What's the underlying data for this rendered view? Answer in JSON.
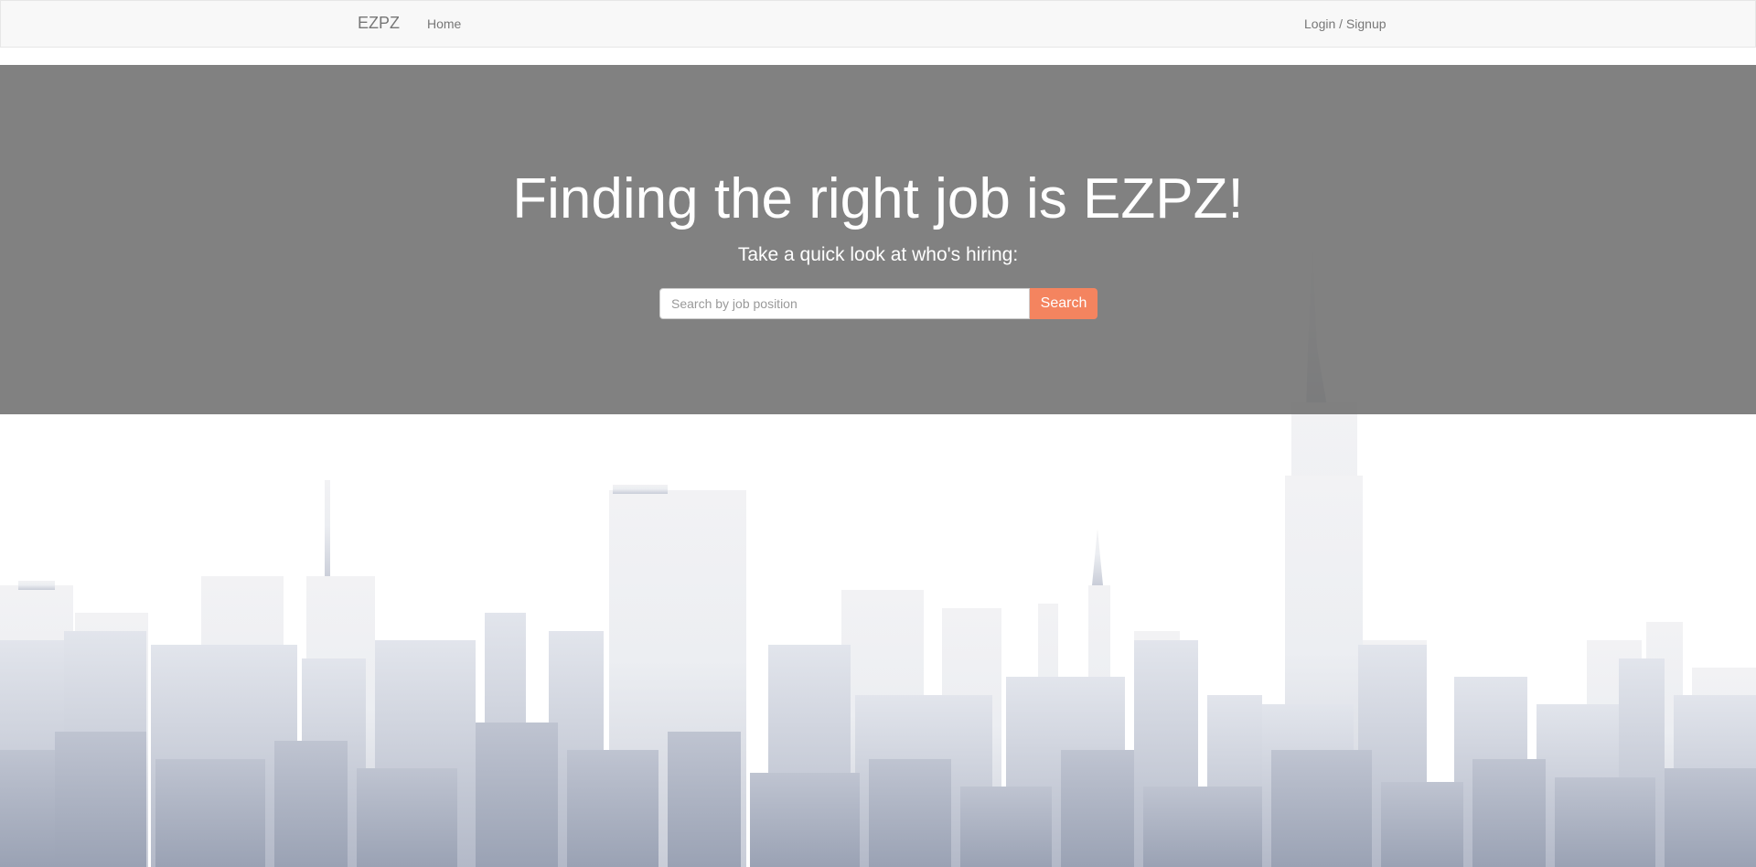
{
  "navbar": {
    "brand": "EZPZ",
    "home_label": "Home",
    "login_label": "Login / Signup"
  },
  "hero": {
    "title": "Finding the right job is EZPZ!",
    "subtitle": "Take a quick look at who's hiring:",
    "search": {
      "placeholder": "Search by job position",
      "value": "",
      "button_label": "Search"
    }
  },
  "colors": {
    "navbar_bg": "#f8f8f8",
    "hero_overlay": "#7f7f7f",
    "search_button": "#f4845f",
    "skyline": "#a4acbd"
  }
}
